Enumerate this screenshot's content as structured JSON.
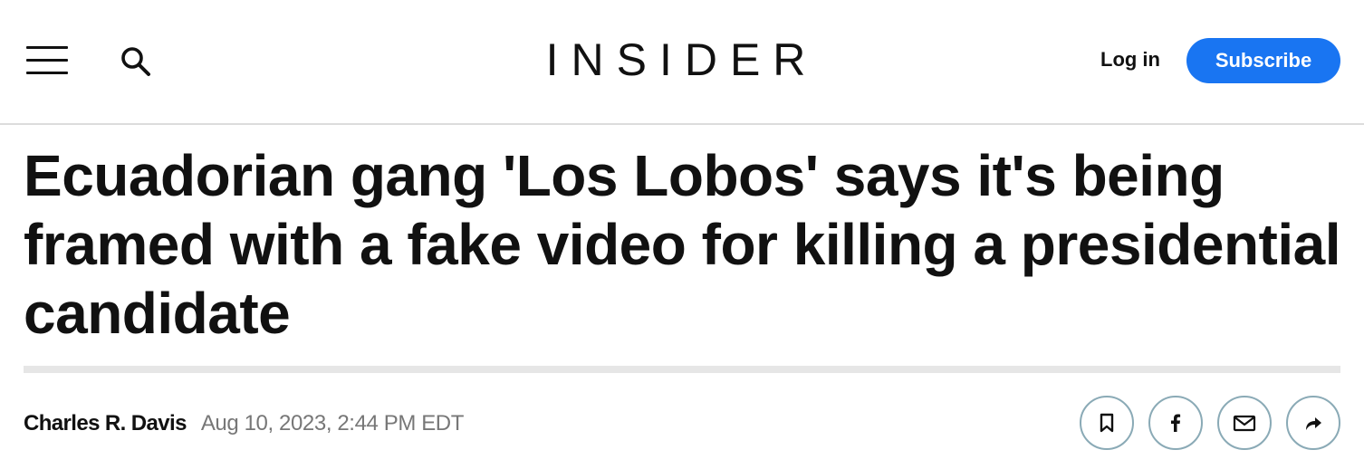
{
  "header": {
    "menu_icon": "hamburger-menu-icon",
    "search_icon": "search-icon",
    "logo": "INSIDER",
    "login_label": "Log in",
    "subscribe_label": "Subscribe"
  },
  "article": {
    "headline": "Ecuadorian gang 'Los Lobos' says it's being framed with a fake video for killing a presidential candidate",
    "author": "Charles R. Davis",
    "date": "Aug 10, 2023, 2:44 PM EDT"
  },
  "share": {
    "icons": [
      "bookmark-icon",
      "facebook-icon",
      "email-icon",
      "share-arrow-icon"
    ]
  },
  "colors": {
    "accent": "#1975f2",
    "share_border": "#8aaab6",
    "muted_text": "#777777",
    "divider": "#e6e6e6"
  }
}
